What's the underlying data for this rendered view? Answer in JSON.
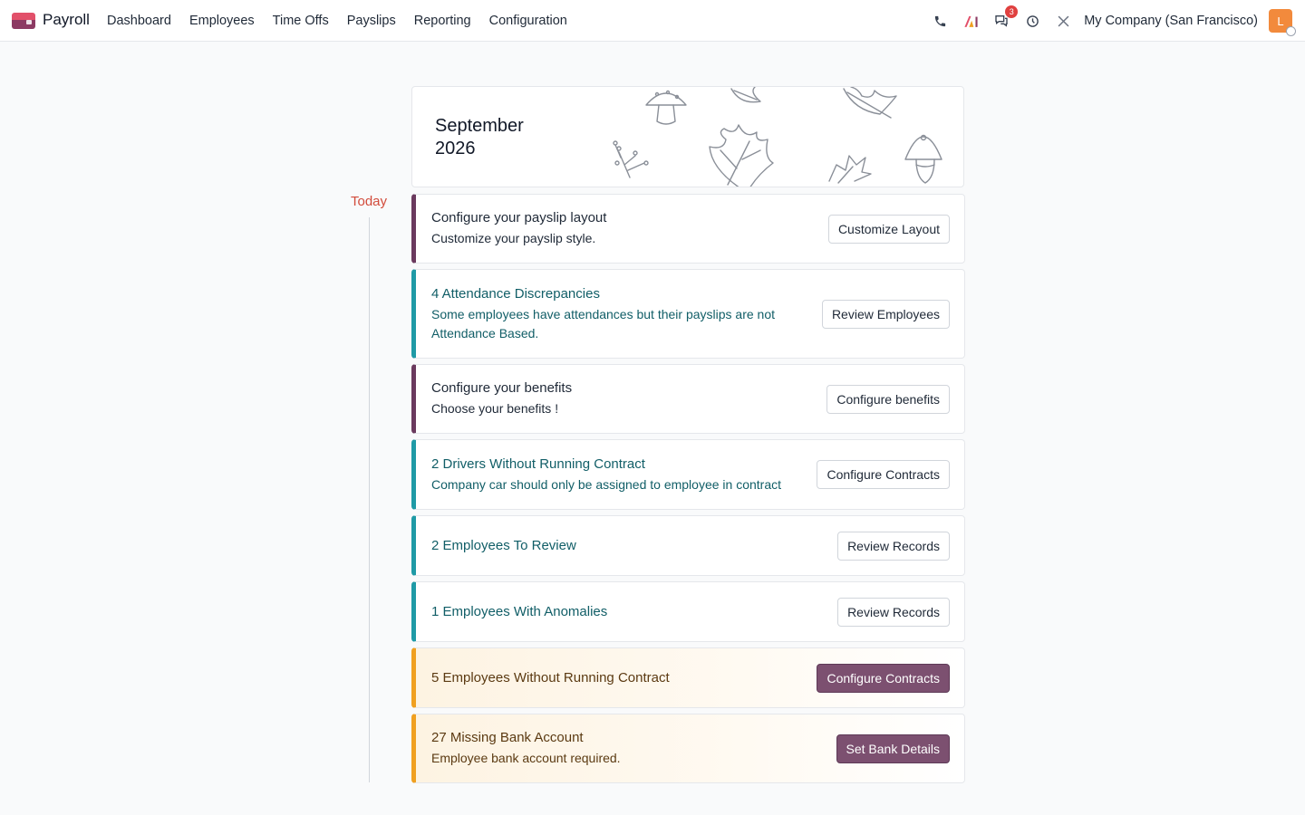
{
  "app": {
    "title": "Payroll",
    "brand_colors": [
      "#e2506a",
      "#8c3a63"
    ]
  },
  "menu": {
    "items": [
      "Dashboard",
      "Employees",
      "Time Offs",
      "Payslips",
      "Reporting",
      "Configuration"
    ]
  },
  "systray": {
    "icons": [
      "phone-icon",
      "ai-icon",
      "chat-icon",
      "clock-icon",
      "tools-icon"
    ],
    "chat_badge": "3",
    "company": "My Company (San Francisco)",
    "avatar_initial": "L",
    "avatar_color": "#f28a3c"
  },
  "timeline": {
    "today_label": "Today",
    "month": "September",
    "year": "2026"
  },
  "cards": [
    {
      "title": "Configure your payslip layout",
      "desc": "Customize your payslip style.",
      "button": "Customize Layout",
      "style": "purple"
    },
    {
      "title": "4 Attendance Discrepancies",
      "desc": "Some employees have attendances but their payslips are not Attendance Based.",
      "button": "Review Employees",
      "style": "teal"
    },
    {
      "title": "Configure your benefits",
      "desc": "Choose your benefits !",
      "button": "Configure benefits",
      "style": "purple"
    },
    {
      "title": "2 Drivers Without Running Contract",
      "desc": "Company car should only be assigned to employee in contract",
      "button": "Configure Contracts",
      "style": "teal"
    },
    {
      "title": "2 Employees To Review",
      "desc": "",
      "button": "Review Records",
      "style": "teal"
    },
    {
      "title": "1 Employees With Anomalies",
      "desc": "",
      "button": "Review Records",
      "style": "teal"
    },
    {
      "title": "5 Employees Without Running Contract",
      "desc": "",
      "button": "Configure Contracts",
      "style": "orange"
    },
    {
      "title": "27 Missing Bank Account",
      "desc": "Employee bank account required.",
      "button": "Set Bank Details",
      "style": "orange"
    }
  ],
  "colors": {
    "teal_accent": "#1f9aa6",
    "purple_accent": "#6b3a5e",
    "warning_accent": "#f0a020",
    "primary_button": "#7c5070",
    "today": "#d24b3b"
  }
}
